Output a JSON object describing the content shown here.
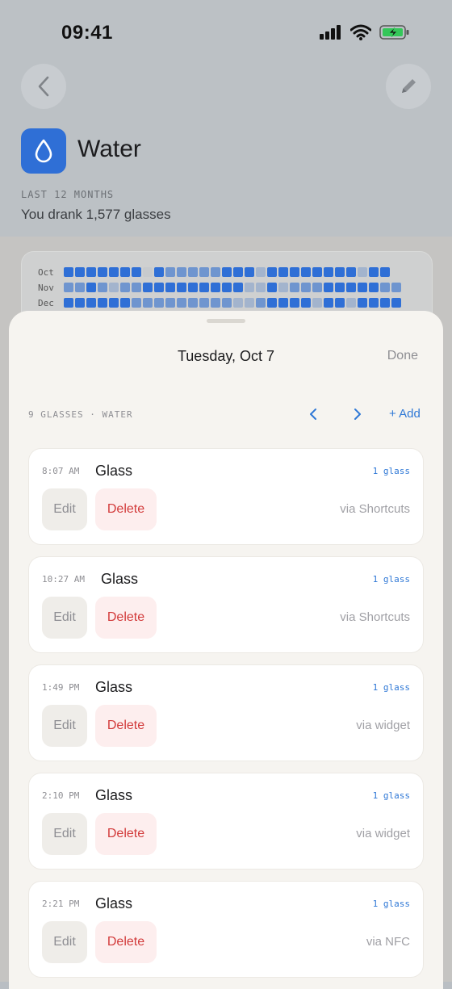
{
  "status_bar": {
    "time": "09:41"
  },
  "header": {
    "title": "Water",
    "period_label": "LAST 12 MONTHS",
    "summary": "You drank 1,577 glasses",
    "icon": "water-drop-icon"
  },
  "heatmap": {
    "rows": [
      {
        "label": "Oct",
        "cells": [
          3,
          3,
          3,
          3,
          3,
          3,
          3,
          0,
          3,
          2,
          2,
          2,
          2,
          2,
          3,
          3,
          3,
          1,
          3,
          3,
          3,
          3,
          3,
          3,
          3,
          3,
          1,
          3,
          3
        ]
      },
      {
        "label": "Nov",
        "cells": [
          2,
          2,
          3,
          2,
          1,
          2,
          2,
          3,
          3,
          3,
          3,
          3,
          3,
          3,
          3,
          3,
          1,
          1,
          3,
          1,
          2,
          2,
          2,
          3,
          3,
          3,
          3,
          3,
          2,
          2
        ]
      },
      {
        "label": "Dec",
        "cells": [
          3,
          3,
          3,
          3,
          3,
          3,
          2,
          2,
          2,
          2,
          2,
          2,
          2,
          2,
          2,
          1,
          1,
          2,
          3,
          3,
          3,
          3,
          1,
          3,
          3,
          1,
          3,
          3,
          3,
          3
        ]
      }
    ],
    "colors": [
      "#c7cacd",
      "#a3b4cd",
      "#6f95cf",
      "#2f6fd6"
    ]
  },
  "sheet": {
    "title": "Tuesday, Oct 7",
    "done_label": "Done",
    "count_label": "9 GLASSES · WATER",
    "add_label": "+ Add"
  },
  "entries": [
    {
      "time": "8:07 AM",
      "name": "Glass",
      "qty": "1 glass",
      "edit": "Edit",
      "delete": "Delete",
      "source": "via Shortcuts"
    },
    {
      "time": "10:27 AM",
      "name": "Glass",
      "qty": "1 glass",
      "edit": "Edit",
      "delete": "Delete",
      "source": "via Shortcuts"
    },
    {
      "time": "1:49 PM",
      "name": "Glass",
      "qty": "1 glass",
      "edit": "Edit",
      "delete": "Delete",
      "source": "via widget"
    },
    {
      "time": "2:10 PM",
      "name": "Glass",
      "qty": "1 glass",
      "edit": "Edit",
      "delete": "Delete",
      "source": "via widget"
    },
    {
      "time": "2:21 PM",
      "name": "Glass",
      "qty": "1 glass",
      "edit": "Edit",
      "delete": "Delete",
      "source": "via NFC"
    }
  ],
  "colors": {
    "accent": "#2f78d6",
    "brand": "#2f6fd6",
    "destructive": "#d23a3a"
  }
}
